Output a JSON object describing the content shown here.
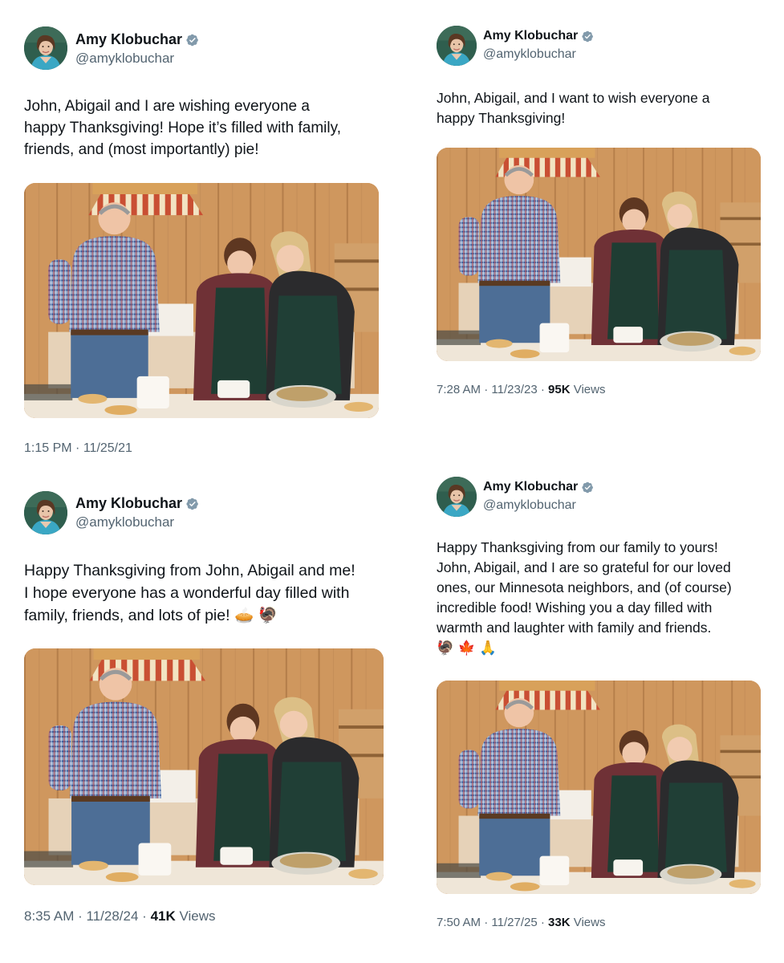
{
  "tweets": [
    {
      "author_name": "Amy Klobuchar",
      "handle": "@amyklobuchar",
      "verified_icon": "verified-badge-icon",
      "text": "John, Abigail and I are wishing everyone a\nhappy Thanksgiving! Hope it’s filled with family,\nfriends, and (most importantly) pie!",
      "emojis": "",
      "time": "1:15 PM",
      "date": "11/25/21",
      "views": "",
      "views_label": ""
    },
    {
      "author_name": "Amy Klobuchar",
      "handle": "@amyklobuchar",
      "verified_icon": "verified-badge-icon",
      "text": "John, Abigail, and I want to wish everyone a\nhappy Thanksgiving!",
      "emojis": "",
      "time": "7:28 AM",
      "date": "11/23/23",
      "views": "95K",
      "views_label": "Views"
    },
    {
      "author_name": "Amy Klobuchar",
      "handle": "@amyklobuchar",
      "verified_icon": "verified-badge-icon",
      "text": "Happy Thanksgiving from John, Abigail and me!\nI hope everyone has a wonderful day filled with\nfamily, friends, and lots of pie!",
      "emojis": "🥧 🦃",
      "time": "8:35 AM",
      "date": "11/28/24",
      "views": "41K",
      "views_label": "Views"
    },
    {
      "author_name": "Amy Klobuchar",
      "handle": "@amyklobuchar",
      "verified_icon": "verified-badge-icon",
      "text": "Happy Thanksgiving from our family to yours!\nJohn, Abigail, and I are so grateful for our loved\nones, our Minnesota neighbors, and (of course)\nincredible food! Wishing you a day filled with\nwarmth and laughter with family and friends.\n",
      "emojis": "🦃 🍁 🙏",
      "time": "7:50 AM",
      "date": "11/27/25",
      "views": "33K",
      "views_label": "Views"
    }
  ],
  "meta_separator": "·",
  "colors": {
    "text": "#0f1419",
    "secondary": "#536471",
    "verified": "#829aab"
  }
}
